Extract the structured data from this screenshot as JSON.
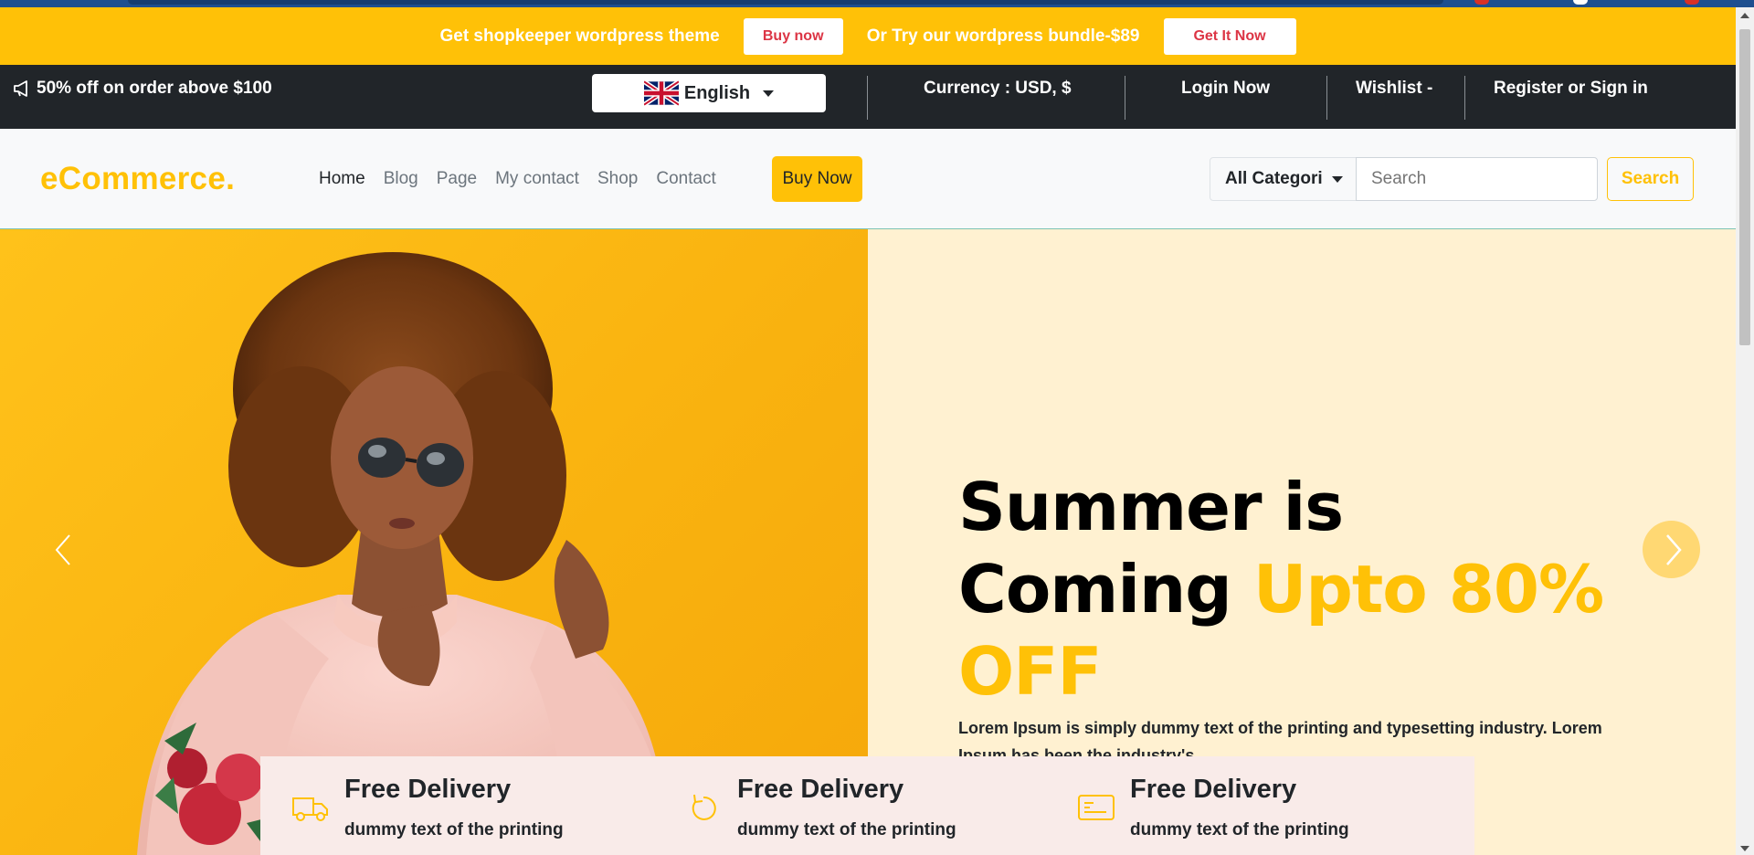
{
  "promo": {
    "text1": "Get shopkeeper wordpress theme",
    "btn1": "Buy now",
    "text2": "Or Try our wordpress bundle-$89",
    "btn2": "Get It Now"
  },
  "topbar": {
    "offer": "50% off on order above $100",
    "language": "English",
    "currency": "Currency : USD, $",
    "login": "Login Now",
    "wishlist": "Wishlist -",
    "register": "Register or Sign in"
  },
  "navbar": {
    "brand": "eCommerce.",
    "links": [
      "Home",
      "Blog",
      "Page",
      "My contact",
      "Shop",
      "Contact"
    ],
    "buy_now": "Buy Now",
    "category": "All Categori",
    "search_placeholder": "Search",
    "search_btn": "Search"
  },
  "hero": {
    "title_line1": "Summer is",
    "title_line2": "Coming ",
    "title_accent": "Upto 80% OFF",
    "description": "Lorem Ipsum is simply dummy text of the printing and typesetting industry. Lorem Ipsum has been the industry's"
  },
  "features": [
    {
      "title": "Free Delivery",
      "sub": "dummy text of the printing",
      "icon": "truck-icon"
    },
    {
      "title": "Free Delivery",
      "sub": "dummy text of the printing",
      "icon": "refresh-icon"
    },
    {
      "title": "Free Delivery",
      "sub": "dummy text of the printing",
      "icon": "credit-card-icon"
    }
  ],
  "colors": {
    "accent": "#ffc107",
    "dark": "#212529",
    "danger": "#dc3545",
    "hero_bg": "#fff1d1",
    "feature_bg": "#f9ebe9"
  }
}
